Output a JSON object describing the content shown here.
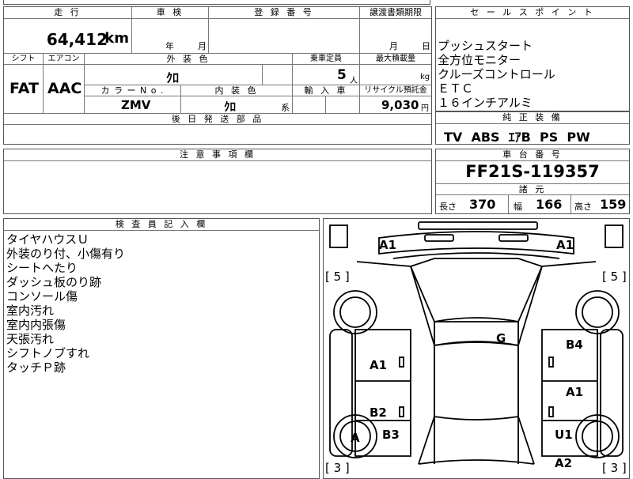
{
  "top_left": {
    "mileage_header": "走 行",
    "mileage_value": "64,412",
    "mileage_unit": "km",
    "inspection_header": "車 検",
    "inspection_year": "年",
    "inspection_month": "月",
    "registration_header": "登 録 番 号",
    "transfer_header": "譲渡書類期限",
    "transfer_month": "月",
    "transfer_day": "日",
    "shift_header": "シフト",
    "ac_header": "エアコン",
    "exterior_color_header": "外 装 色",
    "capacity_header": "乗車定員",
    "max_load_header": "最大積載量",
    "shift_value": "FAT",
    "ac_value": "AAC",
    "exterior_color_value": "ｸﾛ",
    "capacity_value": "5",
    "capacity_unit": "人",
    "max_load_unit": "kg",
    "color_no_header": "カ ラ ー  N o .",
    "interior_color_header": "内 装 色",
    "import_header": "輸 入 車",
    "recycle_header": "リサイクル預託金",
    "color_no_value": "ZMV",
    "interior_color_value": "ｸﾛ",
    "interior_color_suffix": "系",
    "recycle_value": "9,030",
    "recycle_unit": "円",
    "later_parts_header": "後 日 発 送 部 品"
  },
  "sales_points": {
    "header": "セ ー ル ス ポ イ ン ト",
    "items": [
      "プッシュスタート",
      "全方位モニター",
      "クルーズコントロール",
      "ＥＴＣ",
      "１６インチアルミ"
    ]
  },
  "standard_equipment": {
    "header": "純 正 装 備",
    "value": "TV  ABS  ｴｱB  PS  PW"
  },
  "notes": {
    "header": "注 意 事 項 欄"
  },
  "chassis": {
    "header": "車 台 番 号",
    "value": "FF21S-119357",
    "specs_header": "諸 元",
    "length_label": "長さ",
    "length_value": "370",
    "width_label": "幅",
    "width_value": "166",
    "height_label": "高さ",
    "height_value": "159"
  },
  "inspector": {
    "header": "検 査 員 記 入 欄",
    "items": [
      "タイヤハウスＵ",
      "外装のり付、小傷有り",
      "シートへたり",
      "ダッシュ板のり跡",
      "コンソール傷",
      "室内汚れ",
      "室内内張傷",
      "天張汚れ",
      "シフトノブすれ",
      "タッチＰ跡"
    ]
  },
  "diagram": {
    "marks": {
      "front_left": "A1",
      "front_right": "A1",
      "tire_left_front": "[ 5 ]",
      "tire_right_front": "[ 5 ]",
      "roof": "G",
      "left_front_door": "A1",
      "right_front_door": "B4",
      "right_rear_door": "A1",
      "left_rear_door": "B2",
      "left_rear_quarter": "B3",
      "left_rear_wheel": "A",
      "right_rear_quarter": "U1",
      "right_rear": "A2",
      "tire_left_rear": "[ 3 ]",
      "tire_right_rear": "[ 3 ]"
    }
  }
}
